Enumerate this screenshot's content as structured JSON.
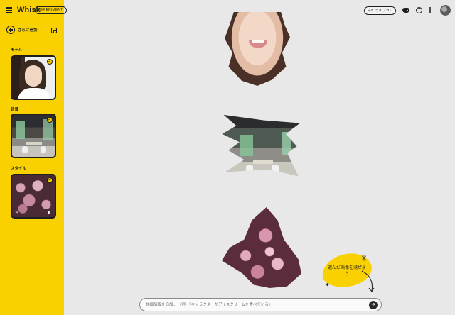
{
  "header": {
    "app_title": "Whisk",
    "badge": "EXPERIMENT",
    "library_label": "マイ ライブラリ"
  },
  "sidebar": {
    "add_more_label": "さらに追加",
    "sections": {
      "model": "モデル",
      "background": "背景",
      "style": "スタイル"
    }
  },
  "hint": {
    "text": "選んだ画像を混ぜよう"
  },
  "prompt": {
    "placeholder": "詳細情報を追加... （例）『キャラクターがアイスクリームを食べている』"
  },
  "icons": {
    "menu": "menu-icon",
    "discord": "discord-icon",
    "help": "help-icon",
    "more": "more-vert-icon",
    "send": "arrow-right-icon"
  },
  "colors": {
    "accent": "#f9d100",
    "canvas": "#e8e8e8"
  }
}
